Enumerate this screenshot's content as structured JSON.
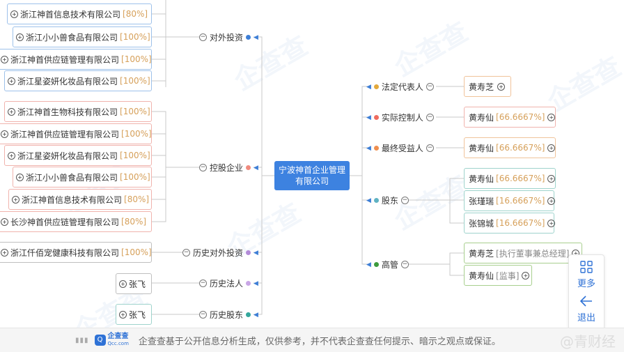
{
  "center_company": "宁波神首企业管理有限公司",
  "branches": {
    "outbound_investment": {
      "label": "对外投资",
      "color": "#3d7ed6"
    },
    "holding_companies": {
      "label": "控股企业",
      "color": "#f08a7e"
    },
    "historical_investment": {
      "label": "历史对外投资",
      "color": "#b38bd8"
    },
    "historical_legal_rep": {
      "label": "历史法人",
      "color": "#c9a6e6"
    },
    "historical_shareholders": {
      "label": "历史股东",
      "color": "#35a79c"
    },
    "legal_rep": {
      "label": "法定代表人",
      "color": "#e3a93c"
    },
    "actual_controller": {
      "label": "实际控制人",
      "color": "#ef6c5f"
    },
    "ultimate_beneficiary": {
      "label": "最终受益人",
      "color": "#ef8f4f"
    },
    "shareholders": {
      "label": "股东",
      "color": "#5fb2c2"
    },
    "executives": {
      "label": "高管",
      "color": "#3d9b3d"
    }
  },
  "outbound_investment_items": [
    {
      "name": "浙江神首信息技术有限公司",
      "pct": "[80%]"
    },
    {
      "name": "浙江小小兽食品有限公司",
      "pct": "[100%]"
    },
    {
      "name": "浙江神首供应链管理有限公司",
      "pct": "[100%]"
    },
    {
      "name": "浙江星姿妍化妆品有限公司",
      "pct": "[100%]"
    }
  ],
  "holding_items": [
    {
      "name": "浙江神首生物科技有限公司",
      "pct": "[100%]"
    },
    {
      "name": "浙江神首供应链管理有限公司",
      "pct": "[100%]"
    },
    {
      "name": "浙江星姿妍化妆品有限公司",
      "pct": "[100%]"
    },
    {
      "name": "浙江小小兽食品有限公司",
      "pct": "[100%]"
    },
    {
      "name": "浙江神首信息技术有限公司",
      "pct": "[80%]"
    },
    {
      "name": "长沙神首供应链管理有限公司",
      "pct": "[80%]"
    }
  ],
  "historical_investment_items": [
    {
      "name": "浙江仟佰宠健康科技有限公司",
      "pct": "[100%]"
    }
  ],
  "historical_legal_rep_items": [
    {
      "name": "张飞"
    }
  ],
  "historical_shareholder_items": [
    {
      "name": "张飞"
    }
  ],
  "legal_rep_items": [
    {
      "name": "黄寿芝"
    }
  ],
  "actual_controller_items": [
    {
      "name": "黄寿仙",
      "pct": "[66.6667%]"
    }
  ],
  "ultimate_beneficiary_items": [
    {
      "name": "黄寿仙",
      "pct": "[66.6667%]"
    }
  ],
  "shareholder_items": [
    {
      "name": "黄寿仙",
      "pct": "[66.6667%]"
    },
    {
      "name": "张瑾瑞",
      "pct": "[16.6667%]"
    },
    {
      "name": "张锦城",
      "pct": "[16.6667%]"
    }
  ],
  "executive_items": [
    {
      "name": "黄寿芝",
      "role": "[执行董事兼总经理]"
    },
    {
      "name": "黄寿仙",
      "role": "[监事]"
    }
  ],
  "footer": {
    "logo_text": "企查查",
    "logo_sub": "Qcc.com",
    "disclaimer": "企查查基于公开信息分析生成，仅供参考，并不代表企查查任何提示、暗示之观点或保证。",
    "watermark_text": "@青财经"
  },
  "side_panel": {
    "more_label": "更多",
    "exit_label": "退出"
  },
  "watermark_brand": "企查查"
}
